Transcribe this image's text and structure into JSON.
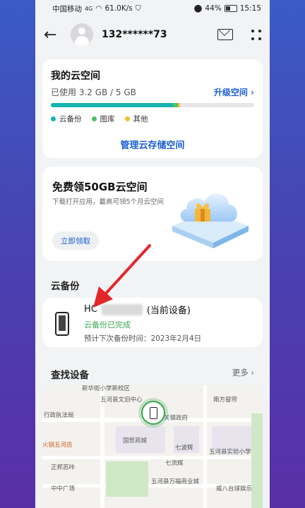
{
  "status_bar": {
    "carrier": "中国移动",
    "network": "4G",
    "speed": "61.0K/s",
    "battery": "44%",
    "time": "15:15"
  },
  "header": {
    "phone": "132******73",
    "back_icon": "back-arrow-icon",
    "mail_icon": "mail-icon",
    "more_icon": "grid-dots-icon"
  },
  "storage": {
    "title": "我的云空间",
    "used": "已使用 3.2 GB / 5 GB",
    "upgrade": "升级空间",
    "usage_fraction": 0.64,
    "segments": [
      {
        "name": "云备份",
        "fraction": 0.6,
        "color": "#17b3b0"
      },
      {
        "name": "图库",
        "fraction": 0.025,
        "color": "#4cc16a"
      },
      {
        "name": "其他",
        "fraction": 0.01,
        "color": "#f2c12e"
      }
    ],
    "manage": "管理云存储空间"
  },
  "promo": {
    "title": "免费领50GB云空间",
    "desc": "下载打开应用，最高可领5个月云空间",
    "button": "立即领取"
  },
  "backup": {
    "section_title": "云备份",
    "device_prefix": "HC",
    "device_suffix": "(当前设备)",
    "status": "云备份已完成",
    "next": "预计下次备份时间：2023年2月4日"
  },
  "find": {
    "title": "查找设备",
    "more": "更多"
  },
  "map": {
    "labels": {
      "top": "新华街小学新校区",
      "culture": "五河县文旧中心",
      "gov_bureau": "行政执法局",
      "guanfu": "关镇政府",
      "south": "南方窗帘",
      "guomao": "国贸商城",
      "xiaobo": "七波辉",
      "hotpot": "火锅五河店",
      "zhengbang": "正邦苏咔",
      "qiliu": "七流辉",
      "school": "五河县实验小学",
      "zhongzhong": "中中广场",
      "wanfu": "五河县万福商业城",
      "weiba": "威八台球娱乐"
    }
  }
}
